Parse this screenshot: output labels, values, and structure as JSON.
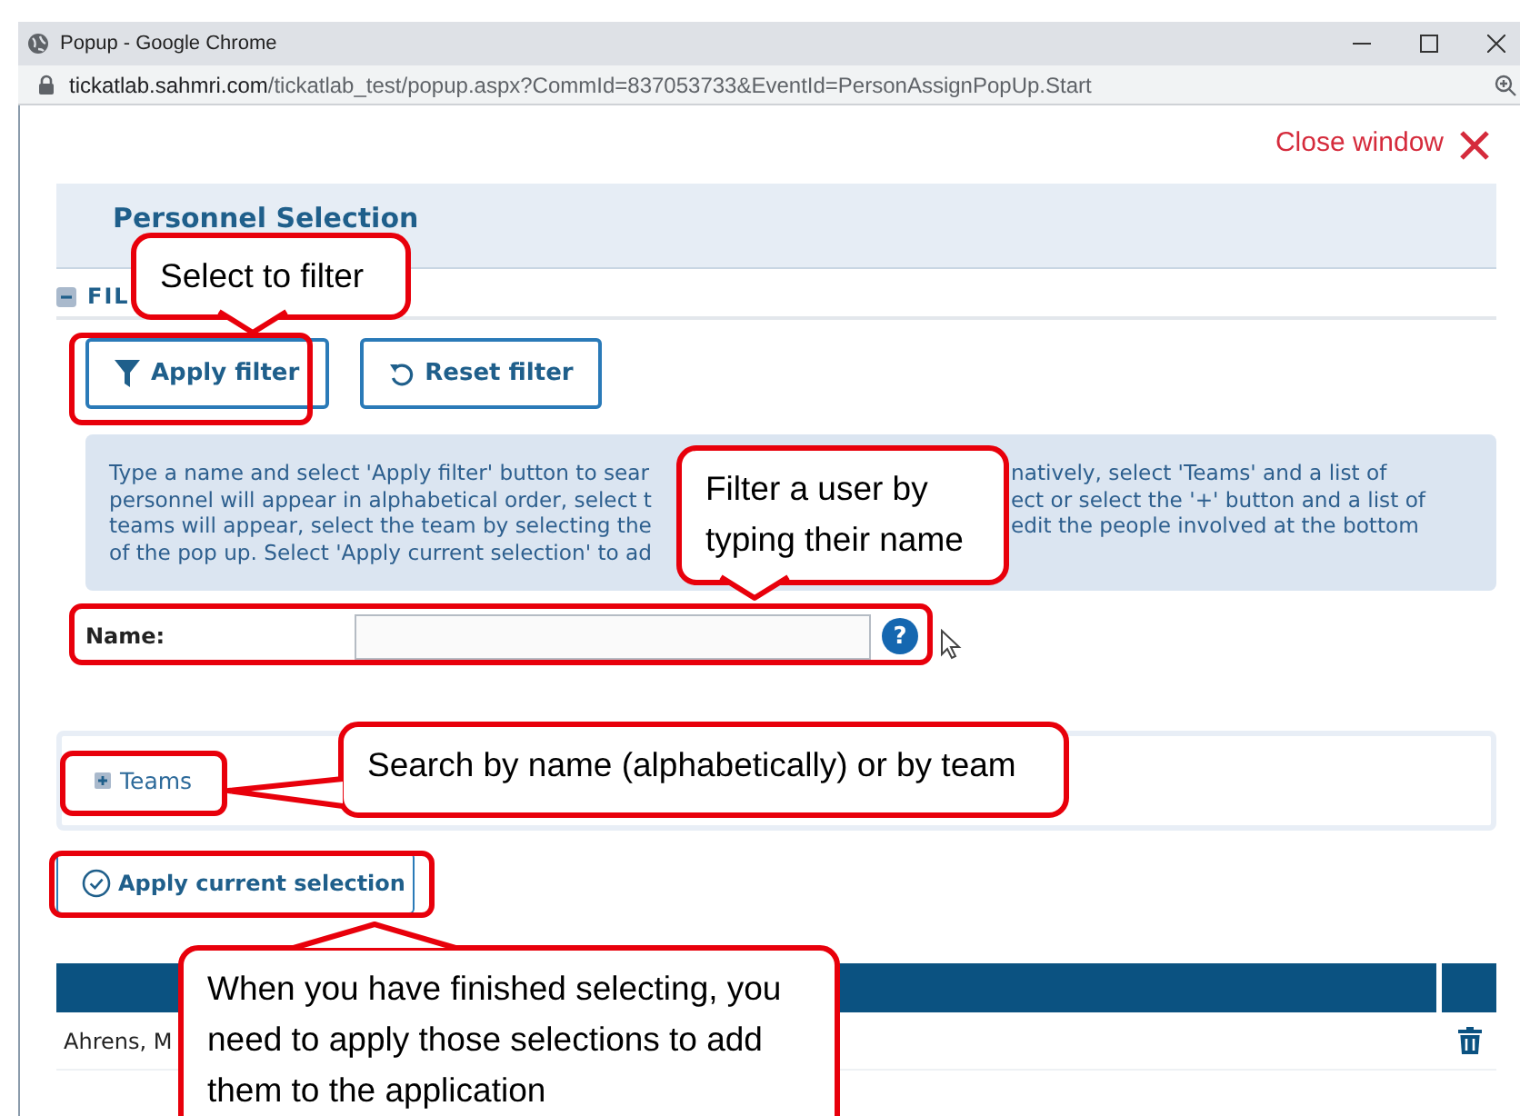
{
  "browser": {
    "title": "Popup - Google Chrome",
    "url_host": "tickatlab.sahmri.com",
    "url_path": "/tickatlab_test/popup.aspx?CommId=837053733&EventId=PersonAssignPopUp.Start"
  },
  "close_link": "Close window",
  "panel_title": "Personnel Selection",
  "filter_section": {
    "label": "FIL",
    "expanded": true
  },
  "buttons": [
    {
      "label": "Apply filter",
      "kind": "filter"
    },
    {
      "label": "Reset filter",
      "kind": "reset"
    }
  ],
  "info_lines": [
    {
      "left": "Type a name and select 'Apply filter' button to sear",
      "right": "natively, select 'Teams' and a list of"
    },
    {
      "left": "personnel will appear in alphabetical order, select t",
      "right": "ect or select the '+' button and a list of"
    },
    {
      "left": "teams will appear, select the team by selecting the",
      "right": "edit the people involved at the bottom"
    },
    {
      "left": "of the pop up. Select 'Apply current selection' to ad"
    }
  ],
  "name_field": {
    "label": "Name:",
    "help": "?"
  },
  "teams": {
    "label": "Teams",
    "expanded": false
  },
  "apply_selection": "Apply current selection",
  "table": {
    "rows": [
      {
        "name": "Ahrens, M"
      }
    ]
  },
  "callouts": [
    {
      "text": "Select to filter",
      "kind": "down"
    },
    {
      "text": "Filter a user by typing their name",
      "kind": "down"
    },
    {
      "text": "Search by name (alphabetically) or by team",
      "kind": "left"
    },
    {
      "text": "When you have finished selecting, you need to apply those selections to add them to the application",
      "kind": "up"
    }
  ]
}
